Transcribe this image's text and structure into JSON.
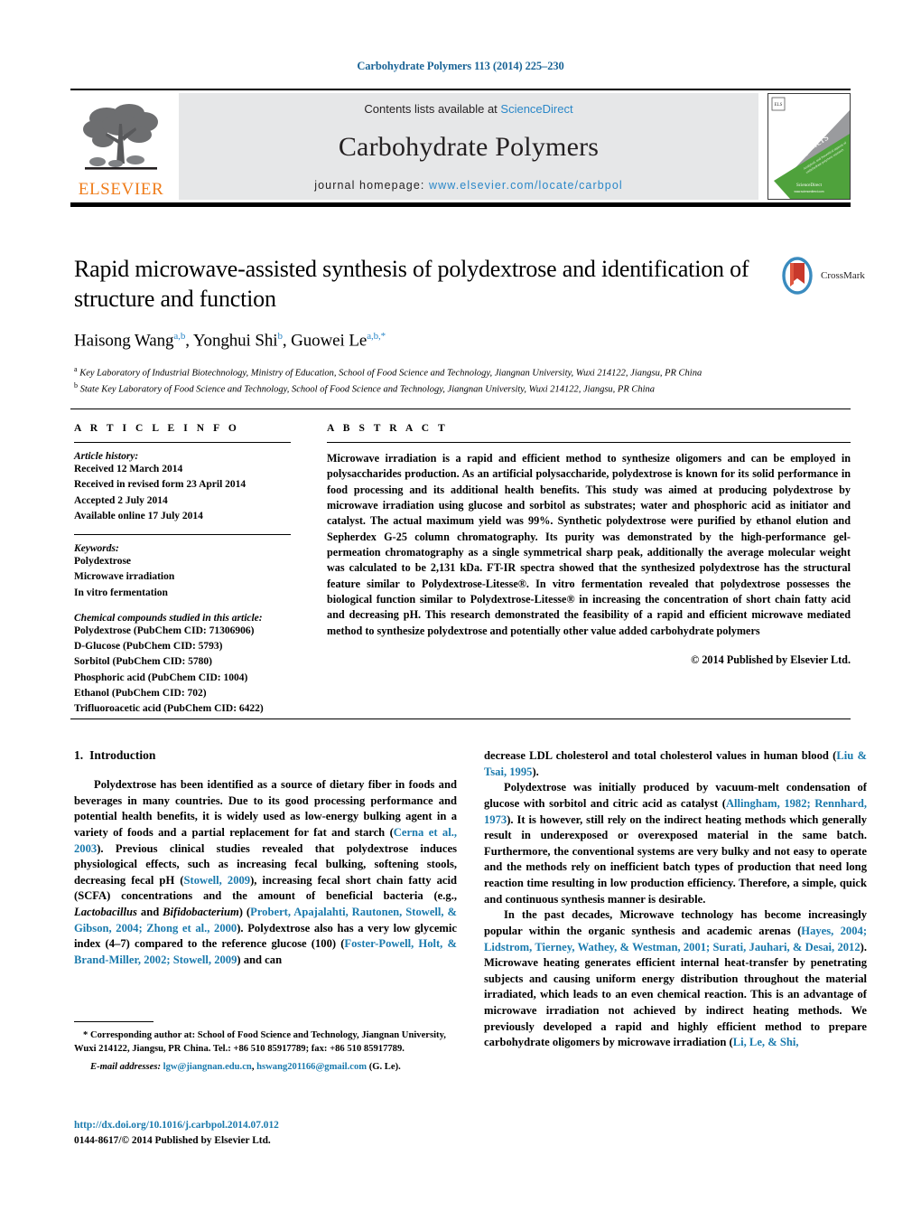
{
  "running_head": "Carbohydrate Polymers 113 (2014) 225–230",
  "masthead": {
    "contents_prefix": "Contents lists available at ",
    "contents_link": "ScienceDirect",
    "journal_title": "Carbohydrate Polymers",
    "homepage_prefix": "journal homepage: ",
    "homepage_url": "www.elsevier.com/locate/carbpol",
    "publisher": "ELSEVIER",
    "cover_title_line1": "Carbohydrate",
    "cover_title_line2": "Polymers",
    "accent_blue": "#2a87c8",
    "elsevier_orange": "#ef7c1a",
    "band_gray": "#e6e7e8"
  },
  "crossmark": {
    "label": "CrossMark"
  },
  "article": {
    "title": "Rapid microwave-assisted synthesis of polydextrose and identification of structure and function",
    "authors_plain": "Haisong Wang a,b, Yonghui Shi b, Guowei Le a,b,*",
    "affiliation_a": "Key Laboratory of Industrial Biotechnology, Ministry of Education, School of Food Science and Technology, Jiangnan University, Wuxi 214122, Jiangsu, PR China",
    "affiliation_b": "State Key Laboratory of Food Science and Technology, School of Food Science and Technology, Jiangnan University, Wuxi 214122, Jiangsu, PR China"
  },
  "article_info": {
    "heading": "A R T I C L E   I N F O",
    "history_label": "Article history:",
    "history": [
      "Received 12 March 2014",
      "Received in revised form 23 April 2014",
      "Accepted 2 July 2014",
      "Available online 17 July 2014"
    ],
    "keywords_label": "Keywords:",
    "keywords": [
      "Polydextrose",
      "Microwave irradiation",
      "In vitro fermentation"
    ],
    "compounds_label": "Chemical compounds studied in this article:",
    "compounds": [
      "Polydextrose (PubChem CID: 71306906)",
      "D-Glucose (PubChem CID: 5793)",
      "Sorbitol (PubChem CID: 5780)",
      "Phosphoric acid (PubChem CID: 1004)",
      "Ethanol (PubChem CID: 702)",
      "Trifluoroacetic acid (PubChem CID: 6422)"
    ]
  },
  "abstract": {
    "heading": "A B S T R A C T",
    "text": "Microwave irradiation is a rapid and efficient method to synthesize oligomers and can be employed in polysaccharides production. As an artificial polysaccharide, polydextrose is known for its solid performance in food processing and its additional health benefits. This study was aimed at producing polydextrose by microwave irradiation using glucose and sorbitol as substrates; water and phosphoric acid as initiator and catalyst. The actual maximum yield was 99%. Synthetic polydextrose were purified by ethanol elution and Sepherdex G-25 column chromatography. Its purity was demonstrated by the high-performance gel-permeation chromatography as a single symmetrical sharp peak, additionally the average molecular weight was calculated to be 2,131 kDa. FT-IR spectra showed that the synthesized polydextrose has the structural feature similar to Polydextrose-Litesse®. In vitro fermentation revealed that polydextrose possesses the biological function similar to Polydextrose-Litesse® in increasing the concentration of short chain fatty acid and decreasing pH. This research demonstrated the feasibility of a rapid and efficient microwave mediated method to synthesize polydextrose and potentially other value added carbohydrate polymers",
    "copyright": "© 2014 Published by Elsevier Ltd."
  },
  "introduction": {
    "number": "1.",
    "title": "Introduction",
    "left_p1_a": "Polydextrose has been identified as a source of dietary fiber in foods and beverages in many countries. Due to its good processing performance and potential health benefits, it is widely used as low-energy bulking agent in a variety of foods and a partial replacement for fat and starch (",
    "left_ref1": "Cerna et al., 2003",
    "left_p1_b": "). Previous clinical studies revealed that polydextrose induces physiological effects, such as increasing fecal bulking, softening stools, decreasing fecal pH (",
    "left_ref2": "Stowell, 2009",
    "left_p1_c": "), increasing fecal short chain fatty acid (SCFA) concentrations and the amount of beneficial bacteria (e.g., ",
    "left_italic1": "Lactobacillus",
    "left_p1_d": " and ",
    "left_italic2": "Bifidobacterium",
    "left_p1_e": ") (",
    "left_ref3": "Probert, Apajalahti, Rautonen, Stowell, & Gibson, 2004; Zhong et al., 2000",
    "left_p1_f": "). Polydextrose also has a very low glycemic index (4–7) compared to the reference glucose (100) (",
    "left_ref4": "Foster-Powell, Holt, & Brand-Miller, 2002; Stowell, 2009",
    "left_p1_g": ") and can",
    "right_p1_a": "decrease LDL cholesterol and total cholesterol values in human blood (",
    "right_ref1": "Liu & Tsai, 1995",
    "right_p1_b": ").",
    "right_p2_a": "Polydextrose was initially produced by vacuum-melt condensation of glucose with sorbitol and citric acid as catalyst (",
    "right_ref2": "Allingham, 1982; Rennhard, 1973",
    "right_p2_b": "). It is however, still rely on the indirect heating methods which generally result in underexposed or overexposed material in the same batch. Furthermore, the conventional systems are very bulky and not easy to operate and the methods rely on inefficient batch types of production that need long reaction time resulting in low production efficiency. Therefore, a simple, quick and continuous synthesis manner is desirable.",
    "right_p3_a": "In the past decades, Microwave technology has become increasingly popular within the organic synthesis and academic arenas (",
    "right_ref3": "Hayes, 2004; Lidstrom, Tierney, Wathey, & Westman, 2001; Surati, Jauhari, & Desai, 2012",
    "right_p3_b": "). Microwave heating generates efficient internal heat-transfer by penetrating subjects and causing uniform energy distribution throughout the material irradiated, which leads to an even chemical reaction. This is an advantage of microwave irradiation not achieved by indirect heating methods. We previously developed a rapid and highly efficient method to prepare carbohydrate oligomers by microwave irradiation (",
    "right_ref4": "Li, Le, & Shi,"
  },
  "footnote": {
    "star_text": "* Corresponding author at: School of Food Science and Technology, Jiangnan University, Wuxi 214122, Jiangsu, PR China. Tel.: +86 510 85917789; fax: +86 510 85917789.",
    "email_label": "E-mail addresses:",
    "email1": "lgw@jiangnan.edu.cn",
    "email_sep": ", ",
    "email2": "hswang201166@gmail.com",
    "email_suffix": " (G. Le)."
  },
  "doi": {
    "url": "http://dx.doi.org/10.1016/j.carbpol.2014.07.012",
    "issn_line": "0144-8617/© 2014 Published by Elsevier Ltd."
  }
}
